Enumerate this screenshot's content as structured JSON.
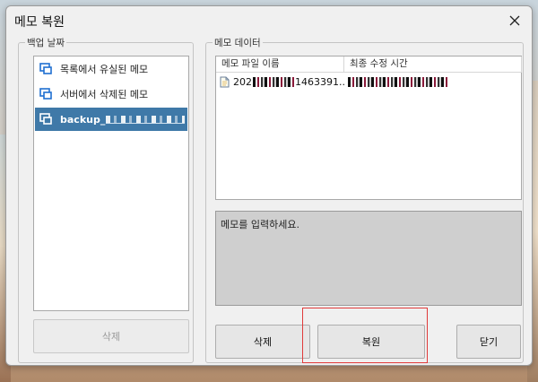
{
  "window": {
    "title": "메모 복원"
  },
  "left_group": {
    "legend": "백업 날짜",
    "items": [
      {
        "label": "목록에서 유실된 메모",
        "icon": "computer-icon"
      },
      {
        "label": "서버에서 삭제된 메모",
        "icon": "computer-icon"
      },
      {
        "label": "backup_",
        "icon": "computer-icon",
        "selected": true
      }
    ],
    "delete_label": "삭제"
  },
  "right_group": {
    "legend": "메모 데이터",
    "columns": [
      "메모 파일 이름",
      "최종 수정 시간"
    ],
    "rows": [
      {
        "name_prefix": "202",
        "name_suffix": "1463391..."
      }
    ],
    "memo_placeholder": "메모를 입력하세요.",
    "delete_label": "삭제",
    "restore_label": "복원",
    "close_label": "닫기"
  },
  "colors": {
    "selection": "#3f79a8",
    "highlight": "#e03a3a"
  }
}
